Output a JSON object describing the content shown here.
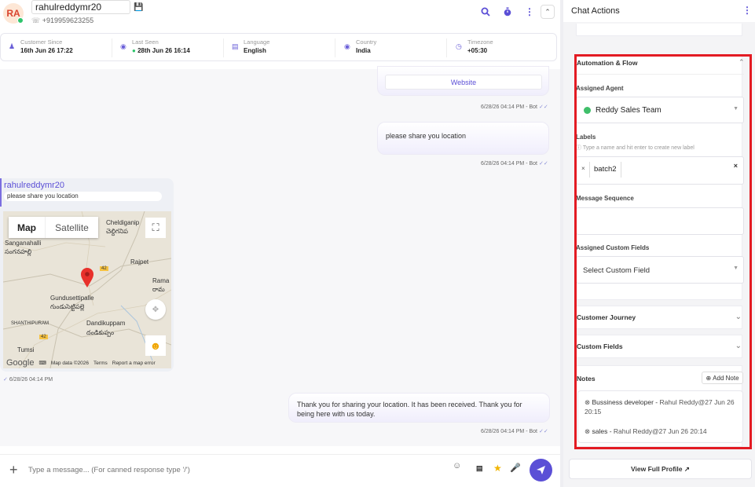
{
  "header": {
    "avatar_initials": "RA",
    "contact_name": "rahulreddymr20",
    "phone": "+919959623255"
  },
  "info_bar": [
    {
      "label": "Customer Since",
      "value": "16th Jun 26 17:22",
      "icon": "user-icon"
    },
    {
      "label": "Last Seen",
      "value": "28th Jun 26 16:14",
      "icon": "eye-icon"
    },
    {
      "label": "Language",
      "value": "English",
      "icon": "translate-icon"
    },
    {
      "label": "Country",
      "value": "India",
      "icon": "location-pin-icon"
    },
    {
      "label": "Timezone",
      "value": "+05:30",
      "icon": "clock-icon"
    }
  ],
  "messages": {
    "website_button": "Website",
    "meta1": "6/28/26 04:14 PM - Bot",
    "bot_msg1": "please share you location",
    "meta2": "6/28/26 04:14 PM - Bot",
    "user_name": "rahulreddymr20",
    "quoted": "please share you location",
    "meta3": "6/28/26 04:14 PM",
    "bot_msg2": "Thank you for sharing your location. It has been received. Thank you for being here with us today.",
    "meta4": "6/28/26 04:14 PM - Bot"
  },
  "map": {
    "tab_map": "Map",
    "tab_satellite": "Satellite",
    "places": [
      "Cheldiganip",
      "చెల్దిగనిప",
      "Sanganahalli",
      "సంగనహల్లి",
      "Rajpet",
      "Rama",
      "రామ",
      "Gundusettipalle",
      "గుండుసెట్టిపల్లె",
      "SHANTHIPURAM",
      "Dandikuppam",
      "దండికుప్పం",
      "Tumsi",
      "42",
      "42"
    ],
    "google": "Google",
    "map_data": "Map data ©2026",
    "terms": "Terms",
    "report": "Report a map error"
  },
  "composer": {
    "placeholder": "Type a message... (For canned response type '/')"
  },
  "right_panel": {
    "title": "Chat Actions",
    "automation_title": "Automation & Flow",
    "assigned_agent_label": "Assigned Agent",
    "assigned_agent_value": "Reddy Sales Team",
    "labels_label": "Labels",
    "labels_hint": "Type a name and hit enter to create new label",
    "label_tag": "batch2",
    "message_sequence_label": "Message Sequence",
    "custom_fields_label": "Assigned Custom Fields",
    "custom_fields_placeholder": "Select Custom Field",
    "customer_journey": "Customer Journey",
    "custom_fields_section": "Custom Fields",
    "notes_title": "Notes",
    "add_note": "Add Note",
    "notes": [
      {
        "title": "Bussiness developer",
        "by": "Rahul Reddy@27 Jun 26",
        "time": "20:15"
      },
      {
        "title": "sales",
        "by": "Rahul Reddy@27 Jun 26 20:14"
      }
    ],
    "view_profile": "View Full Profile"
  },
  "colors": {
    "accent": "#5b4fd6",
    "highlight_border": "#e31b23",
    "online": "#2ec46b"
  }
}
